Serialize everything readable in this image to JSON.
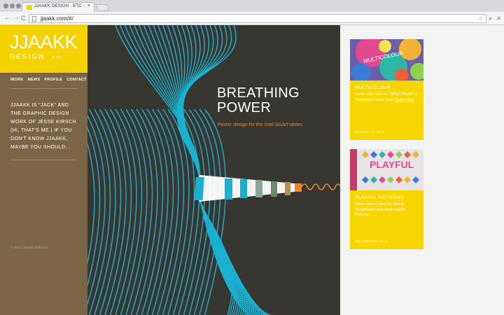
{
  "browser": {
    "tab_title": "JJAAKK DESIGN · ETC ·",
    "tab_close": "×",
    "url": "jjaakk.com/#/",
    "back": "←",
    "forward": "→",
    "reload": "C",
    "star": "☆"
  },
  "site": {
    "logo_main": "JJAAKK",
    "logo_design": "DESIGN",
    "logo_etc": "· ETC ·",
    "nav": [
      "WORK",
      "NEWS",
      "PROFILE",
      "CONTACT"
    ],
    "intro": "JJAAKK IS \"JACK\" AND THE GRAPHIC DESIGN WORK OF JESSE KIRSCH. (HI, THAT'S ME.) IF YOU DON'T KNOW JJAAKK, MAYBE YOU SHOULD...",
    "copyright": "© 2012 JESSE KIRSCH"
  },
  "hero": {
    "title_line1": "BREATHING",
    "title_line2": "POWER",
    "caption": "Poster design for the Intel SciArt series."
  },
  "cards": [
    {
      "title": "MULTICOLOUR",
      "text": "Some color love for \"SPECTRUM\" in Victionary's latest book ",
      "link": "Multicolour",
      "date": "JANUARY 11, 2013",
      "image_text": "MULTICOLOUR"
    },
    {
      "title": "PLAYFUL PATTERNS",
      "text": "Some pattern love for Mali in SendPoint's new book Playful Patterns",
      "date": "DECEMBER 04, 2012",
      "image_text": "PLAYFUL"
    }
  ],
  "colors": {
    "yellow": "#f4d200",
    "sidebar_brown": "#7a6547",
    "hero_dark": "#383630",
    "cyan": "#1ab1d0",
    "orange": "#e4882b"
  }
}
